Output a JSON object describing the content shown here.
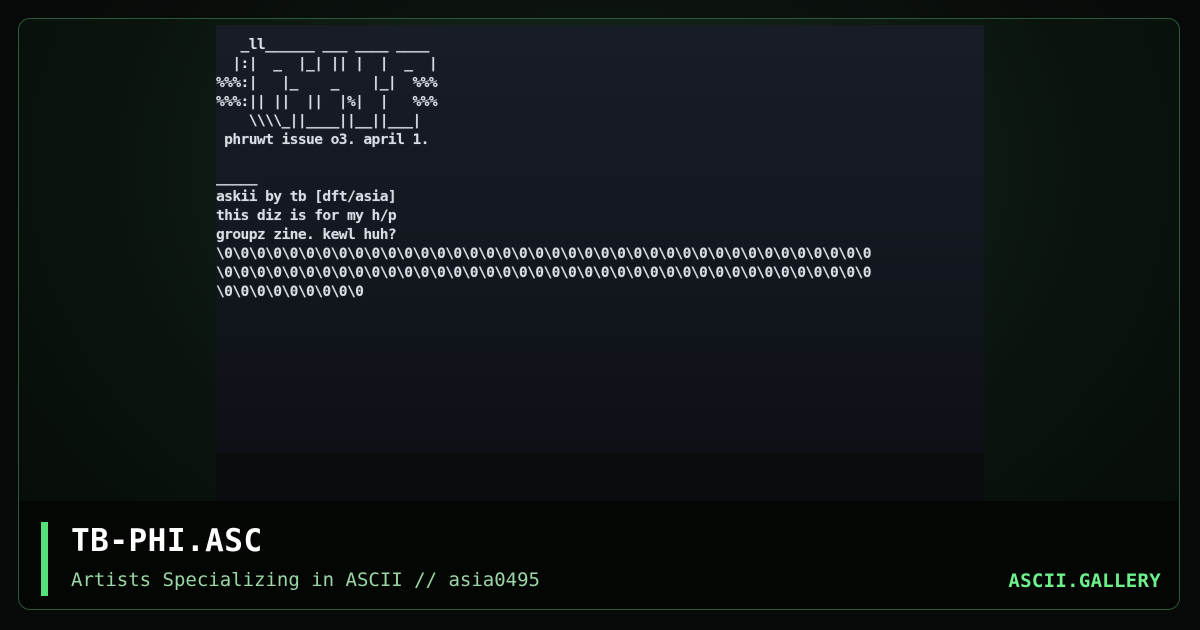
{
  "artwork": {
    "lines": [
      "   _ll______ ___ ____ ____",
      "  |:|  _  |_| || |  |  _  |",
      "%%%:|   |_    _    |_|  %%%",
      "%%%:|| ||  ||  |%|  |   %%%",
      "    \\\\\\\\_||____||__||___|",
      " phruwt issue o3. april 1.",
      "",
      "_____",
      "askii by tb [dft/asia]",
      "this diz is for my h/p",
      "groupz zine. kewl huh?",
      "\\0\\0\\0\\0\\0\\0\\0\\0\\0\\0\\0\\0\\0\\0\\0\\0\\0\\0\\0\\0\\0\\0\\0\\0\\0\\0\\0\\0\\0\\0\\0\\0\\0\\0\\0\\0\\0\\0\\0\\0",
      "\\0\\0\\0\\0\\0\\0\\0\\0\\0\\0\\0\\0\\0\\0\\0\\0\\0\\0\\0\\0\\0\\0\\0\\0\\0\\0\\0\\0\\0\\0\\0\\0\\0\\0\\0\\0\\0\\0\\0\\0",
      "\\0\\0\\0\\0\\0\\0\\0\\0\\0"
    ]
  },
  "footer": {
    "title": "TB-PHI.ASC",
    "subtitle": "Artists Specializing in ASCII // asia0495",
    "brand": "ASCII.GALLERY"
  },
  "colors": {
    "accent": "#55e07a",
    "brand": "#6ef08c",
    "subtitle": "#9ad6a6",
    "frame_border": "#2a5a3a"
  }
}
